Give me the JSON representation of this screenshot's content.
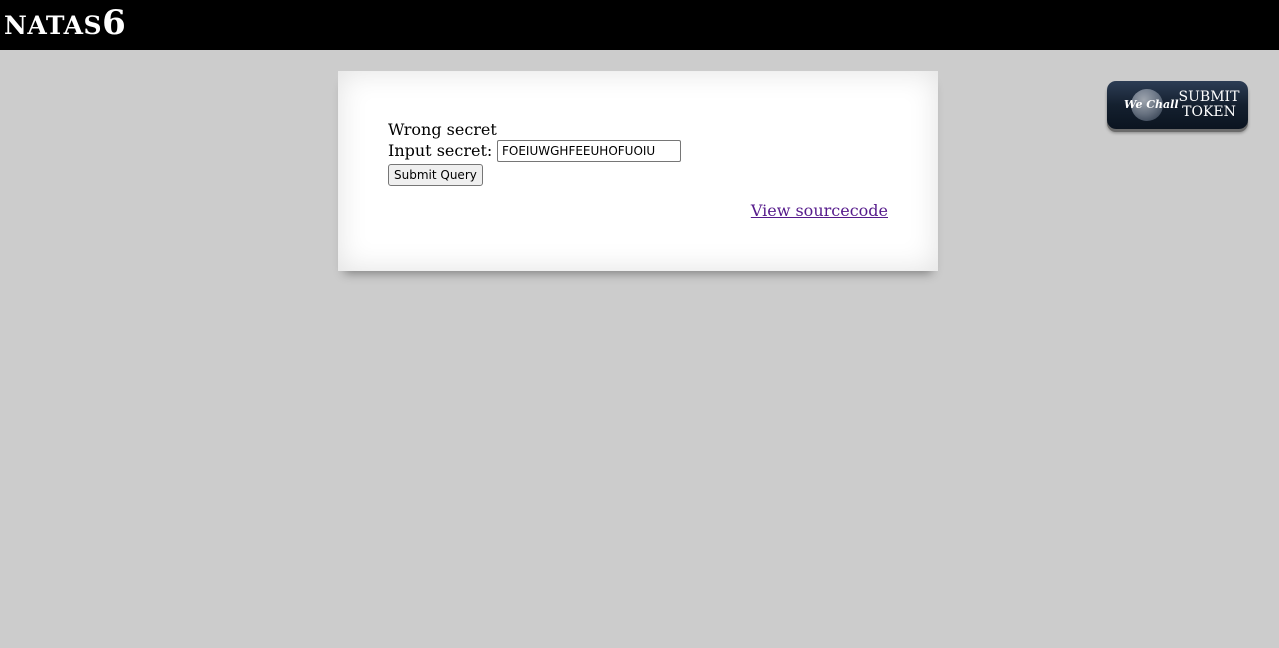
{
  "header": {
    "title_prefix": "NATAS",
    "title_number": "6",
    "background": "#000000"
  },
  "wechall": {
    "logo_text": "We Chall",
    "submit_label": "SUBMIT\nTOKEN"
  },
  "content": {
    "message": "Wrong secret",
    "input_label": "Input secret:",
    "input_value": "FOEIUWGHFEEUHOFUOIU",
    "submit_label": "Submit Query",
    "source_link": "View sourcecode"
  },
  "colors": {
    "page_background": "#cccccc",
    "panel_background": "#ffffff",
    "link_visited": "#551a8b"
  }
}
